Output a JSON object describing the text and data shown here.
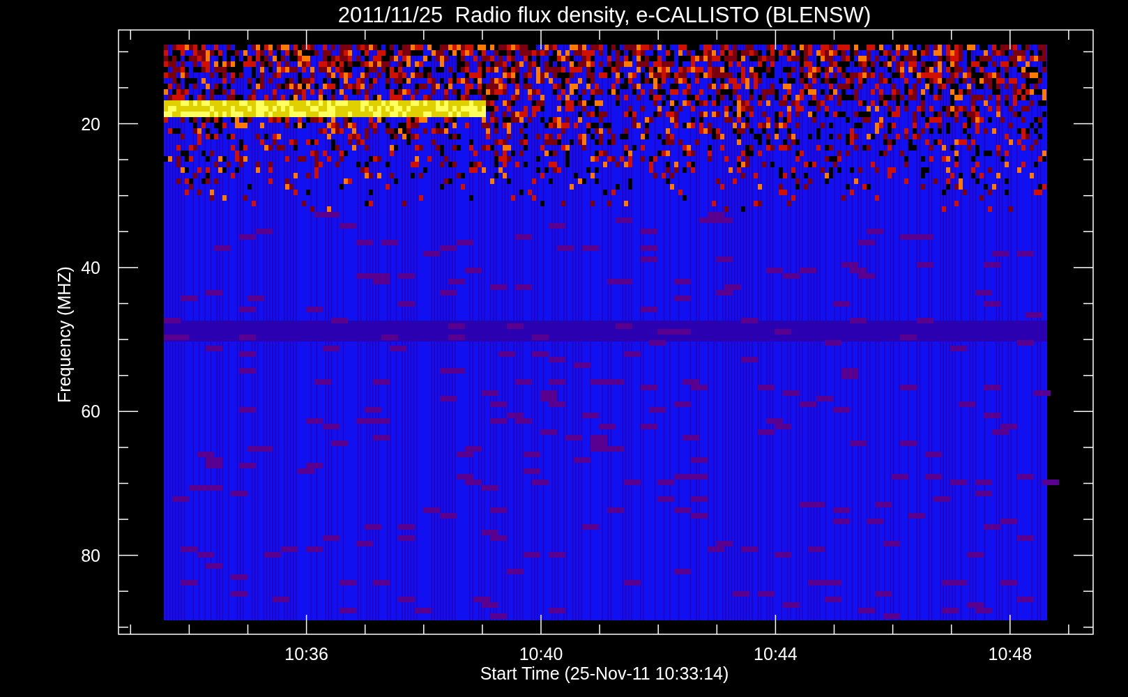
{
  "title": "2011/11/25  Radio flux density, e-CALLISTO (BLENSW)",
  "xlabel": "Start Time (25-Nov-11 10:33:14)",
  "ylabel": "Frequency (MHZ)",
  "yticks": [
    "20",
    "40",
    "60",
    "80"
  ],
  "xticks": [
    "10:36",
    "10:40",
    "10:44",
    "10:48"
  ]
}
